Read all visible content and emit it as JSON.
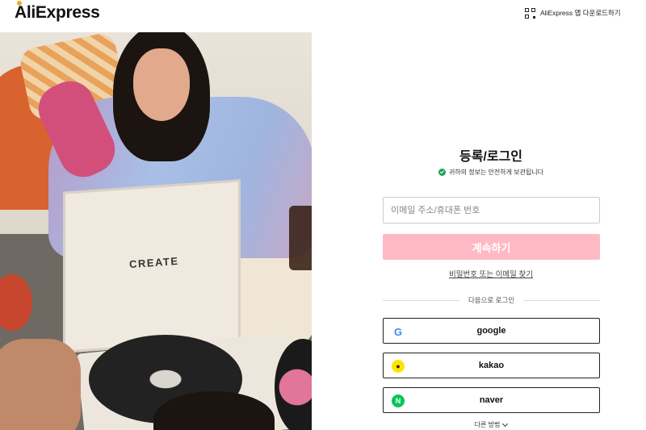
{
  "header": {
    "logo_text": "AliExpress",
    "download_label": "AliExpress 앱 다운로드하기",
    "icons": {
      "download": "qr-code-icon"
    }
  },
  "hero": {
    "case_label": "CREATE"
  },
  "login": {
    "title": "등록/로그인",
    "secure_notice": "귀하의 정보는 안전하게 보관됩니다",
    "input_placeholder": "이메일 주소/휴대폰 번호",
    "input_value": "",
    "continue_label": "계속하기",
    "find_link": "비밀번호 또는 이메일 찾기",
    "divider_label": "다음으로 로그인",
    "social": [
      {
        "label": "google",
        "icon": "google-icon"
      },
      {
        "label": "kakao",
        "icon": "kakao-icon"
      },
      {
        "label": "naver",
        "icon": "naver-icon"
      }
    ],
    "more_label": "다른 방법"
  },
  "colors": {
    "continue_button": "#ffb9c4",
    "secure_icon": "#1aa35a",
    "kakao": "#fee500",
    "naver": "#03c75a",
    "google": "#4285f4"
  }
}
